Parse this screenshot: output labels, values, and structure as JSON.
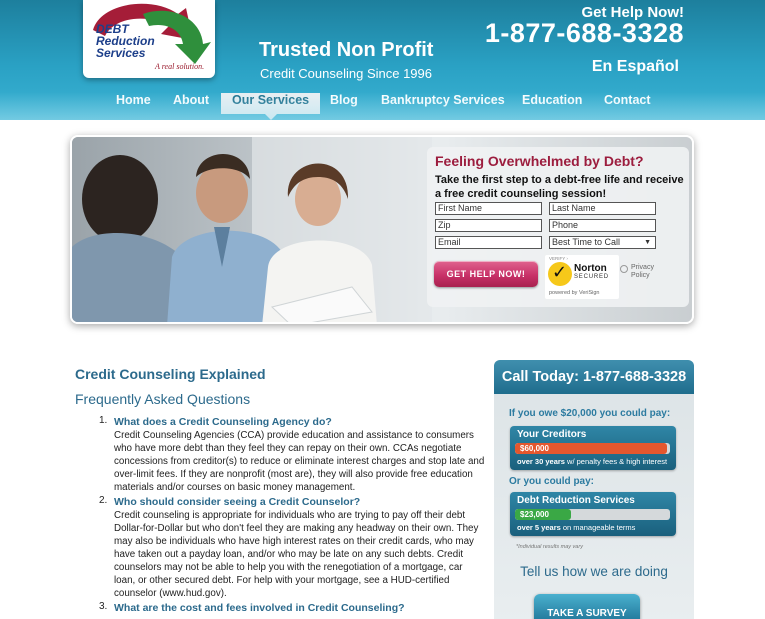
{
  "logo": {
    "line1": "DEBT",
    "line2": "Reduction",
    "line3": "Services",
    "tagline": "A real solution."
  },
  "header": {
    "tagline_main": "Trusted Non Profit",
    "tagline_sub": "Credit Counseling Since 1996",
    "help_now": "Get Help Now!",
    "phone": "1-877-688-3328",
    "language_link": "En Español"
  },
  "nav": {
    "items": [
      {
        "label": "Home"
      },
      {
        "label": "About"
      },
      {
        "label": "Our Services"
      },
      {
        "label": "Blog"
      },
      {
        "label": "Bankruptcy Services"
      },
      {
        "label": "Education"
      },
      {
        "label": "Contact"
      }
    ],
    "active_index": 2
  },
  "hero_form": {
    "title": "Feeling Overwhelmed by Debt?",
    "subtitle": "Take the first step to a debt-free life and receive a free credit counseling session!",
    "fields": {
      "first_name": "First Name",
      "last_name": "Last Name",
      "zip": "Zip",
      "phone": "Phone",
      "email": "Email",
      "best_time": "Best Time to Call"
    },
    "submit_label": "GET HELP NOW!",
    "norton": {
      "verify": "VERIFY ›",
      "brand": "Norton",
      "secured": "SECURED",
      "powered": "powered by VeriSign"
    },
    "privacy": {
      "line1": "Privacy",
      "line2": "Policy"
    }
  },
  "main": {
    "heading": "Credit Counseling Explained",
    "faq_heading": "Frequently Asked Questions",
    "faq": [
      {
        "num": "1.",
        "question": "What does a Credit Counseling Agency do?",
        "answer": "Credit Counseling Agencies (CCA) provide education and assistance to consumers who have more debt than they feel they can repay on their own. CCAs negotiate concessions from creditor(s) to reduce or eliminate interest charges and stop late and over-limit fees. If they are nonprofit (most are), they will also provide free education materials and/or courses on basic money management."
      },
      {
        "num": "2.",
        "question": "Who should consider seeing a Credit Counselor?",
        "answer": "Credit counseling is appropriate for individuals who are trying to pay off their debt Dollar-for-Dollar but who don't feel they are making any headway on their own. They may also be individuals who have high interest rates on their credit cards, who may have taken out a payday loan, and/or who may be late on any such debts. Credit counselors may not be able to help you with the renegotiation of a mortgage, car loan, or other secured debt. For help with your mortgage, see a HUD-certified counselor (www.hud.gov)."
      },
      {
        "num": "3.",
        "question": "What are the cost and fees involved in Credit Counseling?",
        "answer": ""
      }
    ]
  },
  "sidebar": {
    "call_today": "Call Today: 1-877-688-3328",
    "owe_line": "If you owe $20,000 you could pay:",
    "or_line": "Or you could pay:",
    "creditors": {
      "title": "Your Creditors",
      "amount": "$60,000",
      "fill_fraction": 0.98,
      "caption_bold": "over 30 years",
      "caption_rest": " w/ penalty fees & high interest",
      "color": "#e4572e"
    },
    "drs": {
      "title": "Debt Reduction Services",
      "amount": "$23,000",
      "fill_fraction": 0.36,
      "caption_bold": "over 5 years",
      "caption_rest": " on manageable terms",
      "color": "#3aa845"
    },
    "disclaimer": "*Individual results may vary",
    "tell_us": "Tell us how we are doing",
    "survey_label": "TAKE A SURVEY"
  },
  "colors": {
    "header_blue": "#2aa1c4",
    "heading_blue": "#2c6a8c",
    "cta_pink": "#c83168",
    "form_title": "#9c1d3e"
  }
}
